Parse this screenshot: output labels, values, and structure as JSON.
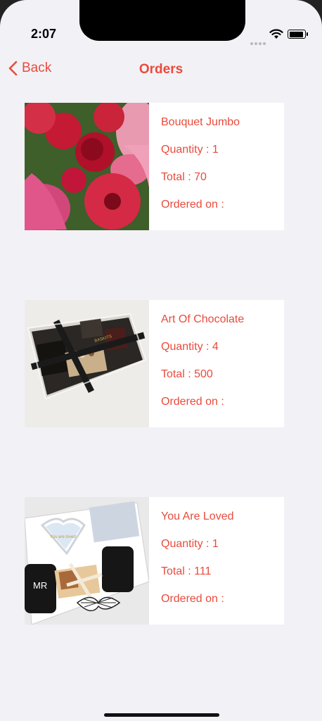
{
  "status_bar": {
    "time": "2:07"
  },
  "nav": {
    "back_label": "Back",
    "title": "Orders"
  },
  "orders": [
    {
      "name": "Bouquet Jumbo",
      "quantity": "Quantity : 1",
      "total": "Total : 70",
      "ordered_on": "Ordered on :"
    },
    {
      "name": "Art Of Chocolate",
      "quantity": "Quantity : 4",
      "total": "Total : 500",
      "ordered_on": "Ordered on :"
    },
    {
      "name": "You Are Loved",
      "quantity": "Quantity : 1",
      "total": "Total : 111",
      "ordered_on": "Ordered on :"
    }
  ],
  "image_text": {
    "ribbon": "BASKITS",
    "plate": "You are loved",
    "mug": "MR"
  },
  "colors": {
    "accent": "#e94b3c",
    "background": "#f2f1f6"
  }
}
